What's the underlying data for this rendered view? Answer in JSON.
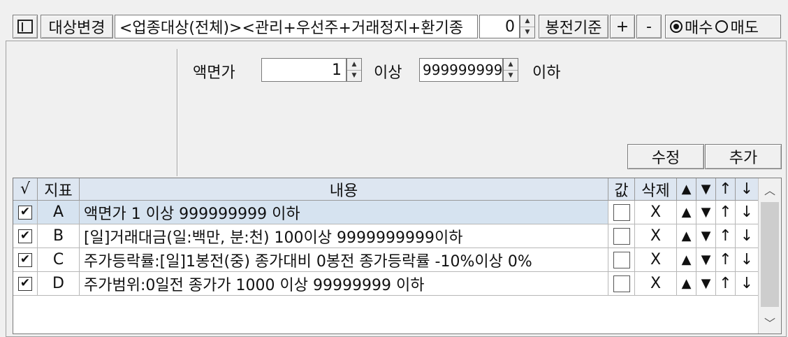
{
  "toolbar": {
    "target_change_label": "대상변경",
    "target_condition_text": "<업종대상(전체)><관리+우선주+거래정지+환기종",
    "spin_value": "0",
    "candle_basis_label": "봉전기준",
    "plus_label": "+",
    "minus_label": "-",
    "buy_label": "매수",
    "sell_label": "매도",
    "buy_selected": true
  },
  "condition": {
    "name_label": "액면가",
    "min_value": "1",
    "min_suffix": "이상",
    "max_value": "999999999",
    "max_suffix": "이하"
  },
  "actions": {
    "edit_label": "수정",
    "add_label": "추가"
  },
  "grid": {
    "headers": {
      "check": "√",
      "indicator": "지표",
      "content": "내용",
      "value": "값",
      "delete": "삭제",
      "move_up": "▲",
      "move_down": "▼",
      "arrow_up": "↑",
      "arrow_down": "↓"
    },
    "rows": [
      {
        "checked": true,
        "id": "A",
        "content": "액면가 1 이상 999999999 이하",
        "delete": "X",
        "up": "▲",
        "down": "▼",
        "uarrow": "↑",
        "darrow": "↓",
        "selected": true
      },
      {
        "checked": true,
        "id": "B",
        "content": "[일]거래대금(일:백만, 분:천) 100이상 9999999999이하",
        "delete": "X",
        "up": "▲",
        "down": "▼",
        "uarrow": "↑",
        "darrow": "↓",
        "selected": false
      },
      {
        "checked": true,
        "id": "C",
        "content": "주가등락률:[일]1봉전(중) 종가대비 0봉전 종가등락률 -10%이상 0%",
        "delete": "X",
        "up": "▲",
        "down": "▼",
        "uarrow": "↑",
        "darrow": "↓",
        "selected": false
      },
      {
        "checked": true,
        "id": "D",
        "content": "주가범위:0일전 종가가 1000 이상 99999999 이하",
        "delete": "X",
        "up": "▲",
        "down": "▼",
        "uarrow": "↑",
        "darrow": "↓",
        "selected": false
      }
    ]
  },
  "colors": {
    "header_bg": "#dde6f1",
    "selected_row_bg": "#d6e3f0"
  }
}
